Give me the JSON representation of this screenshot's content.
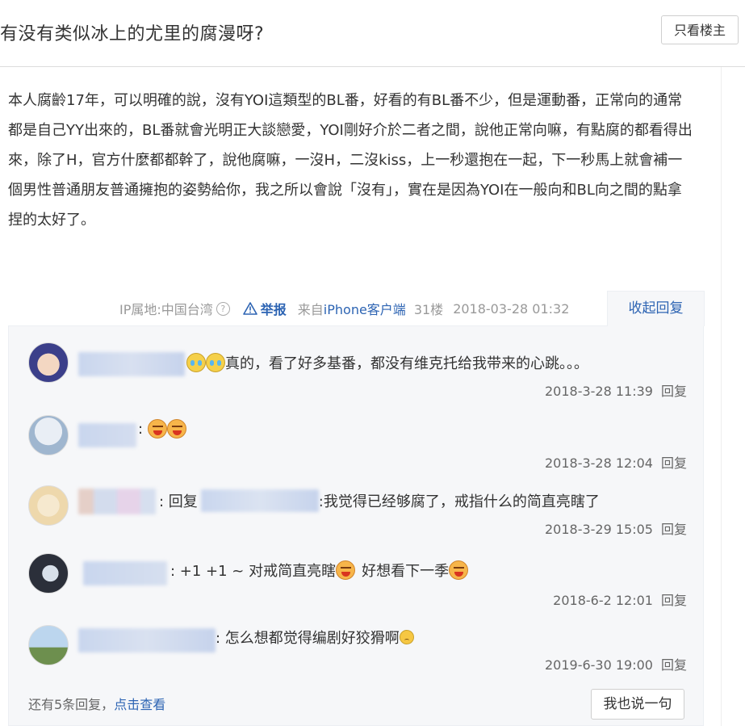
{
  "header": {
    "title": "有没有类似冰上的尤里的腐漫呀?",
    "only_op_label": "只看楼主"
  },
  "post": {
    "body": "本人腐齡17年，可以明確的說，沒有YOI這類型的BL番，好看的有BL番不少，但是運動番，正常向的通常都是自己YY出來的，BL番就會光明正大談戀愛，YOI剛好介於二者之間，說他正常向嘛，有點腐的都看得出來，除了H，官方什麼都都幹了，說他腐嘛，一沒H，二沒kiss，上一秒還抱在一起，下一秒馬上就會補一個男性普通朋友普通擁抱的姿勢給你，我之所以會說「沒有」，實在是因為YOI在一般向和BL向之間的點拿捏的太好了。",
    "ip_location": "IP属地:中国台湾",
    "report_label": "举报",
    "from_prefix": "来自",
    "from_client": "iPhone客户端",
    "floor": "31楼",
    "time": "2018-03-28 01:32",
    "collapse_label": "收起回复"
  },
  "replies": [
    {
      "content": "真的，看了好多基番，都没有维克托给我带来的心跳。。。",
      "emojis": [
        "cry-icon",
        "cry-icon"
      ],
      "time": "2018-3-28 11:39",
      "reply_label": "回复"
    },
    {
      "content": ":",
      "emojis": [
        "laugh-icon",
        "laugh-icon"
      ],
      "time": "2018-3-28 12:04",
      "reply_label": "回复"
    },
    {
      "content_prefix": ": 回复",
      "content": ":我觉得已经够腐了，戒指什么的简直亮瞎了",
      "time": "2018-3-29 15:05",
      "reply_label": "回复"
    },
    {
      "content": ": +1 +1 ~ 对戒简直亮瞎",
      "content_after": "好想看下一季",
      "emojis": [
        "laugh-icon",
        "laugh-icon"
      ],
      "time": "2018-6-2 12:01",
      "reply_label": "回复"
    },
    {
      "content": ": 怎么想都觉得编剧好狡猾啊",
      "emojis": [
        "sad-icon"
      ],
      "time": "2019-6-30 19:00",
      "reply_label": "回复"
    }
  ],
  "footer": {
    "more_prefix": "还有5条回复，",
    "more_link": "点击查看",
    "say_button": "我也说一句"
  },
  "colors": {
    "link": "#2d64b3",
    "reply_bg": "#f6f7f9",
    "meta_text": "#999999"
  }
}
